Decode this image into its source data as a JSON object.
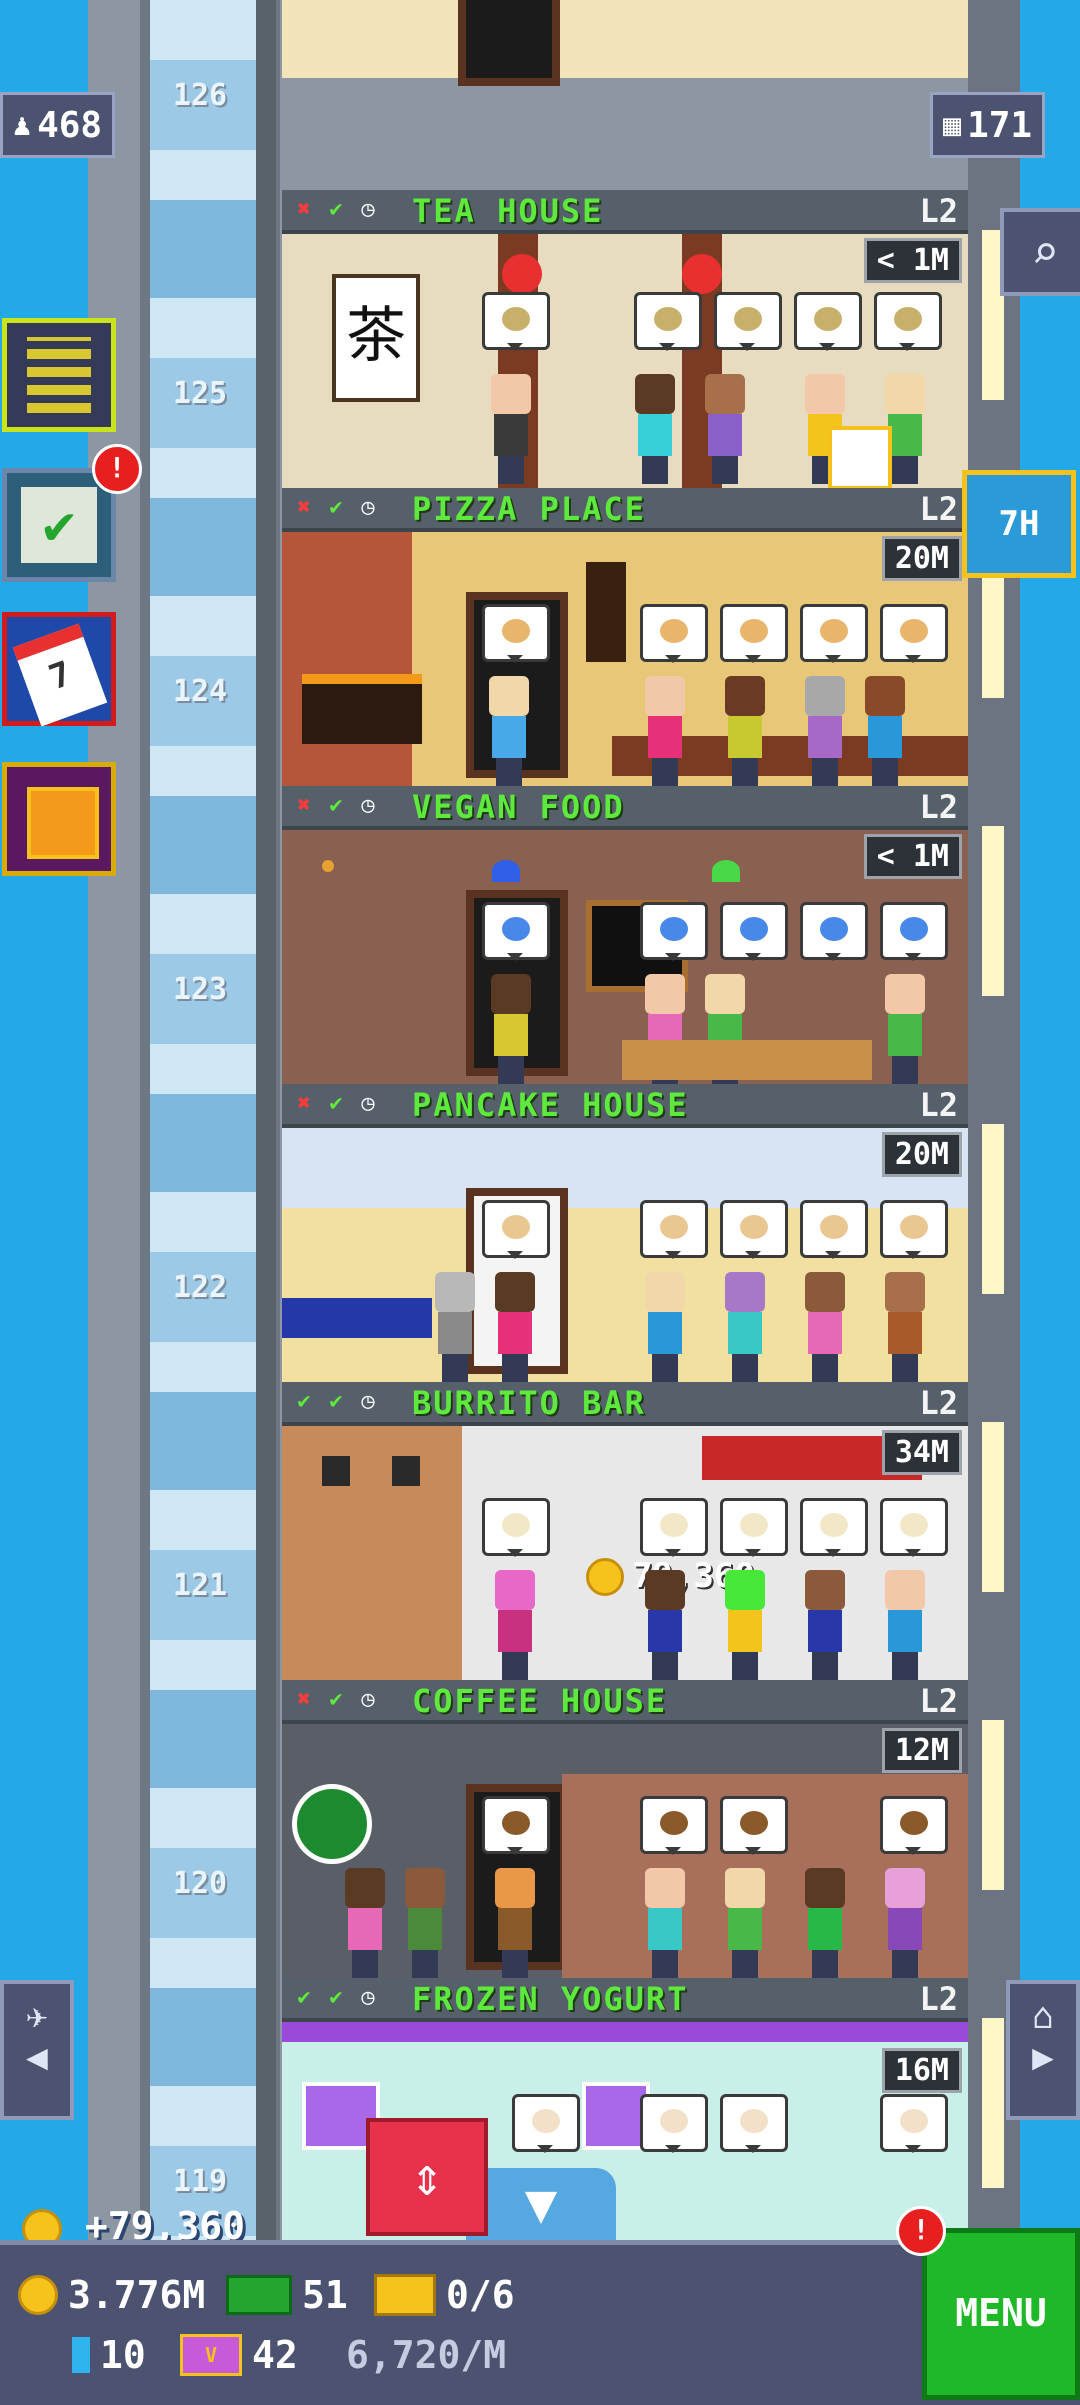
{
  "top": {
    "population": "468",
    "floors": "171"
  },
  "top_floor": {
    "number": "126"
  },
  "floors": [
    {
      "number": "125",
      "name": "TEA HOUSE",
      "level": "L2",
      "timer": "< 1M",
      "checks": [
        "x",
        "check",
        "clock"
      ]
    },
    {
      "number": "124",
      "name": "PIZZA PLACE",
      "level": "L2",
      "timer": "20M",
      "checks": [
        "x",
        "check",
        "clock"
      ]
    },
    {
      "number": "123",
      "name": "VEGAN FOOD",
      "level": "L2",
      "timer": "< 1M",
      "checks": [
        "x",
        "check",
        "clock"
      ]
    },
    {
      "number": "122",
      "name": "PANCAKE HOUSE",
      "level": "L2",
      "timer": "20M",
      "checks": [
        "x",
        "check",
        "clock"
      ]
    },
    {
      "number": "121",
      "name": "BURRITO BAR",
      "level": "L2",
      "timer": "34M",
      "checks": [
        "check",
        "check",
        "clock"
      ]
    },
    {
      "number": "120",
      "name": "COFFEE HOUSE",
      "level": "L2",
      "timer": "12M",
      "checks": [
        "x",
        "check",
        "clock"
      ]
    },
    {
      "number": "119",
      "name": "FROZEN YOGURT",
      "level": "L2",
      "timer": "16M",
      "checks": [
        "check",
        "check",
        "clock"
      ]
    }
  ],
  "floor_text_overlay": "79,360",
  "tea_sign": "茶",
  "side_buttons": [
    "building-icon",
    "missions-icon",
    "calendar-icon",
    "gift-icon"
  ],
  "side_notif": "!",
  "timer_button": "7H",
  "income": "+79,360",
  "bottom": {
    "coins": "3.776M",
    "bux": "51",
    "tickets": "0/6",
    "keys": "10",
    "vip": "42",
    "rate": "6,720/M",
    "menu": "MENU",
    "menu_notif": "!"
  },
  "colors": {
    "sky": "#23a8e8",
    "floor_name": "#5eea3c",
    "menu": "#1eb829",
    "elevator_button": "#e8314a"
  }
}
